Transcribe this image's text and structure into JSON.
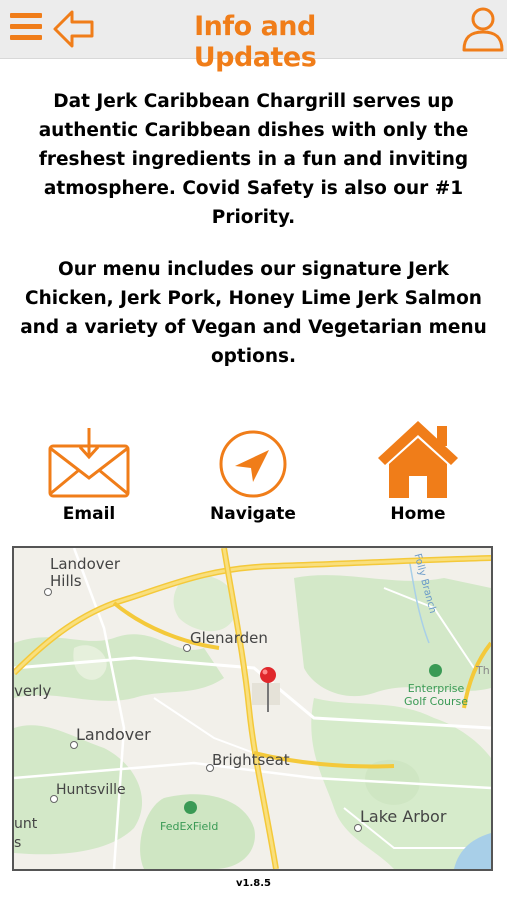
{
  "header": {
    "title": "Info and Updates",
    "menu_icon": "hamburger-menu-icon",
    "back_icon": "back-arrow-icon",
    "profile_icon": "user-profile-icon",
    "accent_color": "#f07d19"
  },
  "description": {
    "paragraph1": "Dat Jerk Caribbean Chargrill serves up authentic Caribbean dishes with only the freshest ingredients in a fun and inviting atmosphere.  Covid Safety is also our #1 Priority.",
    "paragraph2": "Our menu includes our signature Jerk Chicken, Jerk Pork, Honey Lime Jerk Salmon and a variety of Vegan and Vegetarian menu options."
  },
  "actions": [
    {
      "label": "Email",
      "icon": "envelope-icon"
    },
    {
      "label": "Navigate",
      "icon": "navigation-arrow-icon"
    },
    {
      "label": "Home",
      "icon": "house-icon"
    }
  ],
  "map": {
    "labels": {
      "landover_hills": "Landover Hills",
      "glenarden": "Glenarden",
      "verly": "verly",
      "landover": "Landover",
      "brightseat": "Brightseat",
      "huntsville": "Huntsville",
      "fedexfield": "FedExField",
      "lake_arbor": "Lake Arbor",
      "enterprise": "Enterprise Golf Course",
      "folly_branch": "Folly Branch",
      "unt": "unt",
      "s": "s",
      "th": "Th"
    },
    "marker_icon": "map-pin-icon"
  },
  "footer": {
    "version": "v1.8.5"
  }
}
